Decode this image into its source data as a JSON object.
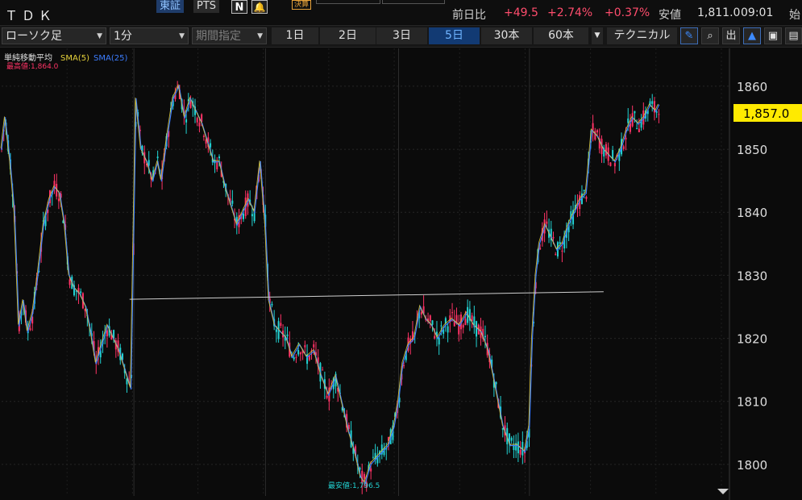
{
  "header": {
    "ticker": "ＴＤＫ",
    "markets": [
      "東証",
      "PTS"
    ],
    "kessan_badge": "決算",
    "change_label": "前日比",
    "change_abs": "+49.5",
    "change_pct": "+2.74%",
    "change_pct2": "+0.37%",
    "low_label": "安値",
    "low_value": "1,811.0",
    "time": "09:01",
    "trailing": "始"
  },
  "toolbar": {
    "chart_type": "ローソク足",
    "interval": "1分",
    "period": "期間指定",
    "ranges": [
      "1日",
      "2日",
      "3日",
      "5日",
      "30本",
      "60本"
    ],
    "active_range": "5日",
    "technical": "テクニカル",
    "out_label": "出"
  },
  "legend": {
    "title": "単純移動平均",
    "sma5": "SMA(5)",
    "sma25": "SMA(25)"
  },
  "annotations": {
    "high": "最高値:1,864.0",
    "low": "最安値:1,796.5"
  },
  "colors": {
    "up": "#ff3366",
    "down": "#22d3d3",
    "sma5": "#e6d23a",
    "sma25": "#3c7dff",
    "active_tab": "#123a73",
    "price_tag": "#ffea00"
  },
  "chart_data": {
    "type": "line",
    "title": "",
    "ylim": [
      1795,
      1866
    ],
    "y_ticks": [
      1800,
      1810,
      1820,
      1830,
      1840,
      1850,
      1860
    ],
    "last_price_label": "1,857.0",
    "last_price": 1857.0,
    "day_boundaries": [
      0.182,
      0.363,
      0.546,
      0.726
    ],
    "series": [
      {
        "name": "",
        "values": [
          {
            "x": 0.0,
            "y": 1850
          },
          {
            "x": 0.005,
            "y": 1855
          },
          {
            "x": 0.012,
            "y": 1848
          },
          {
            "x": 0.018,
            "y": 1840
          },
          {
            "x": 0.024,
            "y": 1822
          },
          {
            "x": 0.03,
            "y": 1826
          },
          {
            "x": 0.036,
            "y": 1821
          },
          {
            "x": 0.043,
            "y": 1824
          },
          {
            "x": 0.05,
            "y": 1830
          },
          {
            "x": 0.058,
            "y": 1838
          },
          {
            "x": 0.066,
            "y": 1842
          },
          {
            "x": 0.073,
            "y": 1844
          },
          {
            "x": 0.08,
            "y": 1843
          },
          {
            "x": 0.087,
            "y": 1838
          },
          {
            "x": 0.093,
            "y": 1830
          },
          {
            "x": 0.1,
            "y": 1828
          },
          {
            "x": 0.108,
            "y": 1827
          },
          {
            "x": 0.116,
            "y": 1825
          },
          {
            "x": 0.123,
            "y": 1821
          },
          {
            "x": 0.13,
            "y": 1816
          },
          {
            "x": 0.138,
            "y": 1819
          },
          {
            "x": 0.146,
            "y": 1822
          },
          {
            "x": 0.154,
            "y": 1820
          },
          {
            "x": 0.162,
            "y": 1818
          },
          {
            "x": 0.17,
            "y": 1815
          },
          {
            "x": 0.178,
            "y": 1812
          },
          {
            "x": 0.185,
            "y": 1858
          },
          {
            "x": 0.192,
            "y": 1850
          },
          {
            "x": 0.2,
            "y": 1848
          },
          {
            "x": 0.208,
            "y": 1845
          },
          {
            "x": 0.215,
            "y": 1848
          },
          {
            "x": 0.22,
            "y": 1845
          },
          {
            "x": 0.228,
            "y": 1852
          },
          {
            "x": 0.236,
            "y": 1858
          },
          {
            "x": 0.244,
            "y": 1860
          },
          {
            "x": 0.252,
            "y": 1855
          },
          {
            "x": 0.26,
            "y": 1858
          },
          {
            "x": 0.268,
            "y": 1856
          },
          {
            "x": 0.276,
            "y": 1854
          },
          {
            "x": 0.284,
            "y": 1851
          },
          {
            "x": 0.292,
            "y": 1848
          },
          {
            "x": 0.3,
            "y": 1848
          },
          {
            "x": 0.308,
            "y": 1844
          },
          {
            "x": 0.316,
            "y": 1841
          },
          {
            "x": 0.324,
            "y": 1838
          },
          {
            "x": 0.332,
            "y": 1840
          },
          {
            "x": 0.34,
            "y": 1842
          },
          {
            "x": 0.348,
            "y": 1840
          },
          {
            "x": 0.356,
            "y": 1848
          },
          {
            "x": 0.363,
            "y": 1838
          },
          {
            "x": 0.368,
            "y": 1826
          },
          {
            "x": 0.376,
            "y": 1822
          },
          {
            "x": 0.384,
            "y": 1821
          },
          {
            "x": 0.392,
            "y": 1820
          },
          {
            "x": 0.4,
            "y": 1817
          },
          {
            "x": 0.41,
            "y": 1819
          },
          {
            "x": 0.42,
            "y": 1817
          },
          {
            "x": 0.43,
            "y": 1818
          },
          {
            "x": 0.44,
            "y": 1814
          },
          {
            "x": 0.45,
            "y": 1811
          },
          {
            "x": 0.46,
            "y": 1814
          },
          {
            "x": 0.47,
            "y": 1809
          },
          {
            "x": 0.478,
            "y": 1805
          },
          {
            "x": 0.486,
            "y": 1802
          },
          {
            "x": 0.494,
            "y": 1798
          },
          {
            "x": 0.5,
            "y": 1797
          },
          {
            "x": 0.508,
            "y": 1800
          },
          {
            "x": 0.516,
            "y": 1801
          },
          {
            "x": 0.524,
            "y": 1802
          },
          {
            "x": 0.532,
            "y": 1803
          },
          {
            "x": 0.54,
            "y": 1806
          },
          {
            "x": 0.546,
            "y": 1810
          },
          {
            "x": 0.552,
            "y": 1816
          },
          {
            "x": 0.56,
            "y": 1819
          },
          {
            "x": 0.568,
            "y": 1820
          },
          {
            "x": 0.576,
            "y": 1825
          },
          {
            "x": 0.584,
            "y": 1823
          },
          {
            "x": 0.592,
            "y": 1822
          },
          {
            "x": 0.6,
            "y": 1820
          },
          {
            "x": 0.61,
            "y": 1822
          },
          {
            "x": 0.62,
            "y": 1823
          },
          {
            "x": 0.63,
            "y": 1822
          },
          {
            "x": 0.64,
            "y": 1824
          },
          {
            "x": 0.65,
            "y": 1822
          },
          {
            "x": 0.66,
            "y": 1821
          },
          {
            "x": 0.67,
            "y": 1818
          },
          {
            "x": 0.68,
            "y": 1812
          },
          {
            "x": 0.69,
            "y": 1806
          },
          {
            "x": 0.7,
            "y": 1803
          },
          {
            "x": 0.71,
            "y": 1803
          },
          {
            "x": 0.72,
            "y": 1802
          },
          {
            "x": 0.726,
            "y": 1806
          },
          {
            "x": 0.73,
            "y": 1820
          },
          {
            "x": 0.735,
            "y": 1830
          },
          {
            "x": 0.74,
            "y": 1835
          },
          {
            "x": 0.748,
            "y": 1838
          },
          {
            "x": 0.756,
            "y": 1836
          },
          {
            "x": 0.764,
            "y": 1834
          },
          {
            "x": 0.772,
            "y": 1835
          },
          {
            "x": 0.78,
            "y": 1838
          },
          {
            "x": 0.788,
            "y": 1840
          },
          {
            "x": 0.796,
            "y": 1842
          },
          {
            "x": 0.804,
            "y": 1843
          },
          {
            "x": 0.812,
            "y": 1853
          },
          {
            "x": 0.82,
            "y": 1852
          },
          {
            "x": 0.828,
            "y": 1850
          },
          {
            "x": 0.836,
            "y": 1849
          },
          {
            "x": 0.844,
            "y": 1848
          },
          {
            "x": 0.852,
            "y": 1850
          },
          {
            "x": 0.86,
            "y": 1853
          },
          {
            "x": 0.868,
            "y": 1855
          },
          {
            "x": 0.876,
            "y": 1854
          },
          {
            "x": 0.884,
            "y": 1855
          },
          {
            "x": 0.892,
            "y": 1857
          },
          {
            "x": 0.9,
            "y": 1856
          },
          {
            "x": 0.904,
            "y": 1857
          }
        ]
      }
    ],
    "trendline": [
      {
        "x": 0.176,
        "y": 1826.2
      },
      {
        "x": 0.828,
        "y": 1827.4
      }
    ]
  }
}
